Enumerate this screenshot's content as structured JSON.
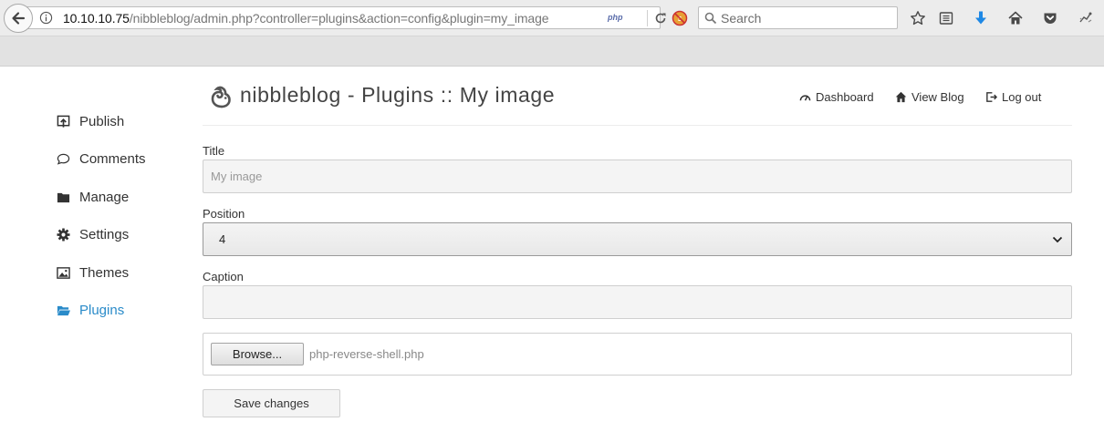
{
  "browser": {
    "url_host": "10.10.10.75",
    "url_path": "/nibbleblog/admin.php?controller=plugins&action=config&plugin=my_image",
    "php_badge": "php",
    "search_placeholder": "Search"
  },
  "sidebar": {
    "items": [
      {
        "label": "Publish",
        "icon": "publish-icon"
      },
      {
        "label": "Comments",
        "icon": "comment-icon"
      },
      {
        "label": "Manage",
        "icon": "folder-icon"
      },
      {
        "label": "Settings",
        "icon": "gear-icon"
      },
      {
        "label": "Themes",
        "icon": "image-icon"
      },
      {
        "label": "Plugins",
        "icon": "folder-open-icon",
        "active": true
      }
    ]
  },
  "header": {
    "title": "nibbleblog - Plugins :: My image",
    "links": {
      "dashboard": "Dashboard",
      "view_blog": "View Blog",
      "log_out": "Log out"
    }
  },
  "form": {
    "title_label": "Title",
    "title_value": "My image",
    "position_label": "Position",
    "position_value": "4",
    "caption_label": "Caption",
    "caption_value": "",
    "browse_label": "Browse...",
    "file_name": "php-reverse-shell.php",
    "save_label": "Save changes"
  },
  "colors": {
    "accent": "#2a8bc9",
    "download_arrow": "#1e88e5"
  }
}
